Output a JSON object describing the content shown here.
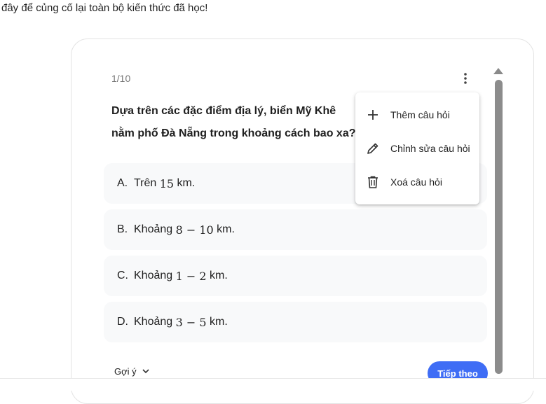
{
  "intro_text": "đây để củng cố lại toàn bộ kiến thức đã học!",
  "quiz": {
    "counter": "1/10",
    "question": "Dựa trên các đặc điểm địa lý, biển Mỹ Khê nằm phố Đà Nẵng trong khoảng cách bao xa?",
    "options": [
      {
        "letter": "A.",
        "prefix": "Trên ",
        "math": "15",
        "suffix": " km."
      },
      {
        "letter": "B.",
        "prefix": "Khoảng ",
        "math": "8 − 10",
        "suffix": " km."
      },
      {
        "letter": "C.",
        "prefix": "Khoảng ",
        "math": "1 − 2",
        "suffix": " km."
      },
      {
        "letter": "D.",
        "prefix": "Khoảng ",
        "math": "3 − 5",
        "suffix": " km."
      }
    ],
    "hint_label": "Gợi ý",
    "next_label": "Tiếp theo"
  },
  "menu": {
    "items": [
      {
        "label": "Thêm câu hỏi",
        "icon": "plus-icon"
      },
      {
        "label": "Chỉnh sửa câu hỏi",
        "icon": "pencil-icon"
      },
      {
        "label": "Xoá câu hỏi",
        "icon": "trash-icon"
      }
    ]
  },
  "colors": {
    "accent": "#3f6df5",
    "option_bg": "#f8f9fa",
    "scrollbar": "#8c8c8c"
  }
}
